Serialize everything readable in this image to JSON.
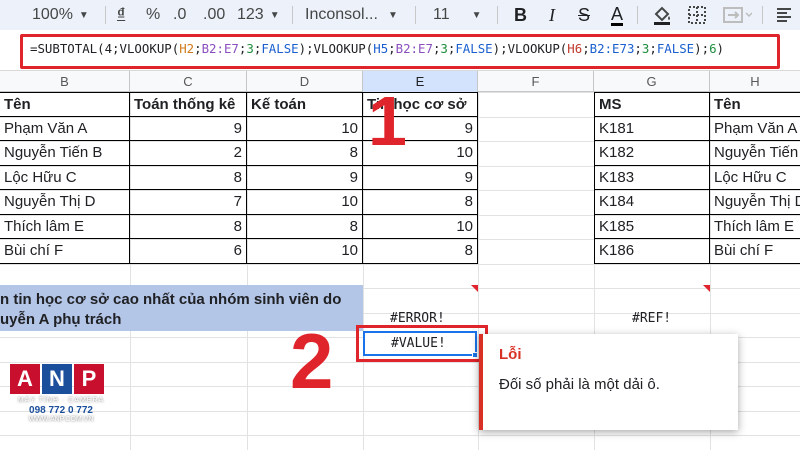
{
  "toolbar": {
    "zoom": "100%",
    "currency": "₫",
    "percent": "%",
    "decrease_decimal": ".0",
    "increase_decimal": ".00",
    "number_format": "123",
    "font_name": "Inconsol...",
    "font_size": "11",
    "bold": "B",
    "italic": "I",
    "strikethrough": "S",
    "text_color": "A"
  },
  "formula": {
    "parts": [
      "=SUBTOTAL(4;VLOOKUP(",
      "H2",
      ";",
      "B2:E7",
      ";",
      "3",
      ";",
      "FALSE",
      ");VLOOKUP(",
      "H5",
      ";",
      "B2:E7",
      ";",
      "3",
      ";",
      "FALSE",
      ");VLOOKUP(",
      "H6",
      ";",
      "B2:E73",
      ";",
      "3",
      ";",
      "FALSE",
      ");",
      "6",
      ")"
    ]
  },
  "columns": [
    "B",
    "C",
    "D",
    "E",
    "F",
    "G",
    "H"
  ],
  "table1": {
    "headers": [
      "Tên",
      "Toán thống kê",
      "Kế toán",
      "Tin học cơ sở"
    ],
    "rows": [
      [
        "Phạm Văn A",
        "9",
        "10",
        "9"
      ],
      [
        "Nguyễn Tiến B",
        "2",
        "8",
        "10"
      ],
      [
        "Lộc Hữu C",
        "8",
        "9",
        "9"
      ],
      [
        "Nguyễn Thị D",
        "7",
        "10",
        "8"
      ],
      [
        "Thích lâm E",
        "8",
        "8",
        "10"
      ],
      [
        "Bùi chí F",
        "6",
        "10",
        "8"
      ]
    ]
  },
  "table2": {
    "headers": [
      "MS",
      "Tên"
    ],
    "rows": [
      [
        "K181",
        "Phạm Văn A"
      ],
      [
        "K182",
        "Nguyễn Tiến B"
      ],
      [
        "K183",
        "Lộc Hữu C"
      ],
      [
        "K184",
        "Nguyễn Thị D"
      ],
      [
        "K185",
        "Thích lâm E"
      ],
      [
        "K186",
        "Bùi chí F"
      ]
    ]
  },
  "band": {
    "line1": "n tin học cơ sở cao nhất của nhóm sinh viên do",
    "line2": "uyễn A phụ trách"
  },
  "errors": {
    "e_error": "#ERROR!",
    "h_ref": "#REF!",
    "e_value": "#VALUE!"
  },
  "popup": {
    "title": "Lỗi",
    "message": "Đối số phải là một dải ô."
  },
  "annotations": {
    "one": "1",
    "two": "2"
  },
  "logo": {
    "letters": [
      "A",
      "N",
      "P"
    ],
    "tagline": "MÁY TÍNH · CAMERA",
    "phone": "098 772 0 772",
    "website": "WWW.ANP.COM.VN"
  },
  "colors": {
    "highlight_red": "#e0242b",
    "selection_blue": "#1a73e8",
    "band_blue": "#b4c6e7",
    "error_red": "#d93025"
  }
}
